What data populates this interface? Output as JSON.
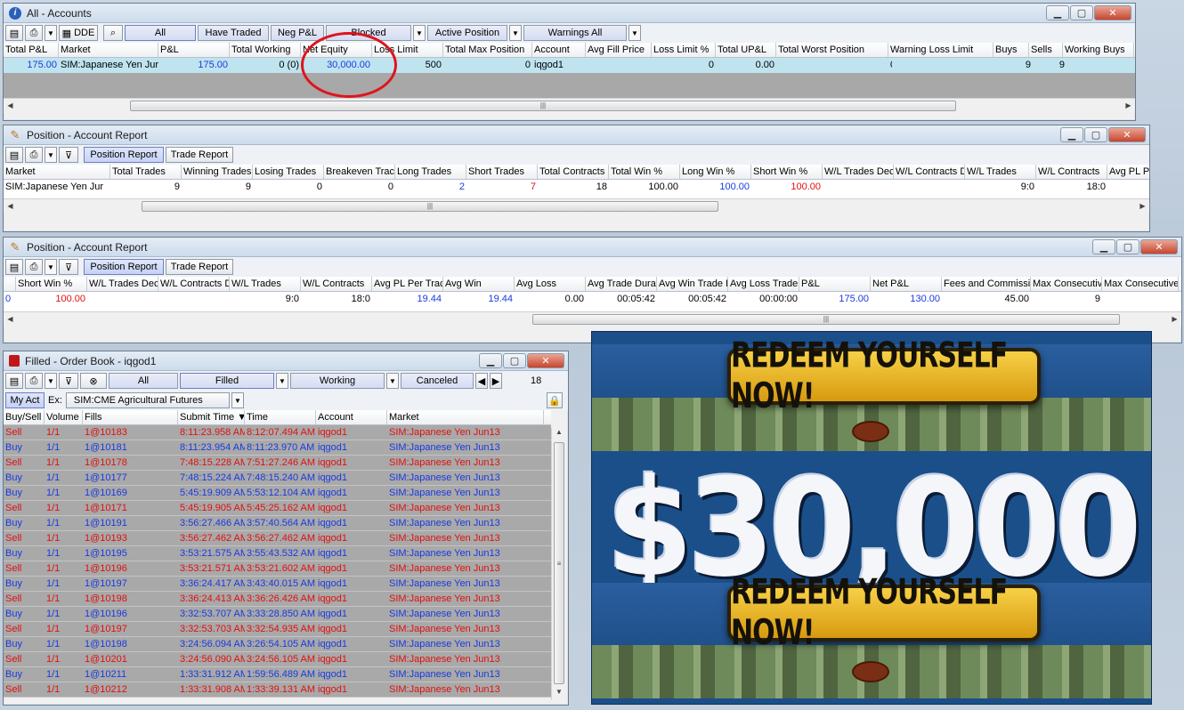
{
  "accounts_window": {
    "title": "All - Accounts",
    "toolbar": {
      "dde_label": "DDE",
      "filters": [
        "All",
        "Have Traded",
        "Neg P&L",
        "Blocked",
        "Active Position",
        "Warnings All"
      ]
    },
    "columns": [
      "Total P&L",
      "Market",
      "P&L",
      "Total Working",
      "Net Equity",
      "Loss Limit",
      "Total Max Position",
      "Account",
      "Avg Fill Price",
      "Loss Limit %",
      "Total UP&L",
      "Total Worst Position",
      "Warning Loss Limit",
      "Buys",
      "Sells",
      "Working Buys"
    ],
    "row": {
      "total_pl": "175.00",
      "market": "SIM:Japanese Yen Jur",
      "pl": "175.00",
      "total_working": "0 (0)",
      "net_equity": "30,000.00",
      "loss_limit": "500",
      "total_max_position": "0",
      "account": "iqgod1",
      "loss_limit_pct": "0",
      "total_upl": "0.00",
      "warning_loss_limit": "0",
      "buys": "9",
      "sells": "9"
    }
  },
  "position_report_1": {
    "title": "Position - Account Report",
    "tabs": [
      "Position Report",
      "Trade Report"
    ],
    "columns": [
      "Market",
      "Total Trades",
      "Winning Trades",
      "Losing Trades",
      "Breakeven Trac",
      "Long Trades",
      "Short Trades",
      "Total Contracts",
      "Total Win %",
      "Long Win %",
      "Short Win %",
      "W/L Trades Dec",
      "W/L Contracts D",
      "W/L Trades",
      "W/L Contracts",
      "Avg PL P"
    ],
    "row": {
      "market": "SIM:Japanese Yen Jur",
      "total_trades": "9",
      "winning_trades": "9",
      "losing_trades": "0",
      "breakeven": "0",
      "long_trades": "2",
      "short_trades": "7",
      "total_contracts": "18",
      "total_win": "100.00",
      "long_win": "100.00",
      "short_win": "100.00",
      "wl_trades": "9:0",
      "wl_contracts": "18:0"
    }
  },
  "position_report_2": {
    "title": "Position - Account Report",
    "tabs": [
      "Position Report",
      "Trade Report"
    ],
    "columns": [
      "Short Win %",
      "W/L Trades Dec",
      "W/L Contracts D",
      "W/L Trades",
      "W/L Contracts",
      "Avg PL Per Trac",
      "Avg Win",
      "Avg Loss",
      "Avg Trade Dura",
      "Avg Win Trade D",
      "Avg Loss Trade",
      "P&L",
      "Net P&L",
      "Fees and Commissi",
      "Max Consecutiv",
      "Max Consecutive"
    ],
    "row": {
      "lead": "0",
      "short_win": "100.00",
      "wl_trades": "9:0",
      "wl_contracts": "18:0",
      "avg_pl_per_trade": "19.44",
      "avg_win": "19.44",
      "avg_loss": "0.00",
      "avg_trade_duration": "00:05:42",
      "avg_win_trade_duration": "00:05:42",
      "avg_loss_trade_duration": "00:00:00",
      "pl": "175.00",
      "net_pl": "130.00",
      "fees": "45.00",
      "max_consecutive": "9"
    }
  },
  "order_book": {
    "title": "Filled - Order Book - iqgod1",
    "filters": [
      "All",
      "Filled",
      "Working",
      "Canceled"
    ],
    "count": "18",
    "my_act_label": "My Act",
    "ex_label": "Ex:",
    "exchange_value": "SIM:CME Agricultural Futures",
    "columns": [
      "Buy/Sell",
      "Volume",
      "Fills",
      "Submit Time",
      "Time",
      "Account",
      "Market"
    ],
    "rows": [
      {
        "side": "Sell",
        "volume": "1/1",
        "fills": "1@10183",
        "submit": "8:11:23.958 AM",
        "time": "8:12:07.494 AM",
        "account": "iqgod1",
        "market": "SIM:Japanese Yen Jun13"
      },
      {
        "side": "Buy",
        "volume": "1/1",
        "fills": "1@10181",
        "submit": "8:11:23.954 AM",
        "time": "8:11:23.970 AM",
        "account": "iqgod1",
        "market": "SIM:Japanese Yen Jun13"
      },
      {
        "side": "Sell",
        "volume": "1/1",
        "fills": "1@10178",
        "submit": "7:48:15.228 AM",
        "time": "7:51:27.246 AM",
        "account": "iqgod1",
        "market": "SIM:Japanese Yen Jun13"
      },
      {
        "side": "Buy",
        "volume": "1/1",
        "fills": "1@10177",
        "submit": "7:48:15.224 AM",
        "time": "7:48:15.240 AM",
        "account": "iqgod1",
        "market": "SIM:Japanese Yen Jun13"
      },
      {
        "side": "Buy",
        "volume": "1/1",
        "fills": "1@10169",
        "submit": "5:45:19.909 AM",
        "time": "5:53:12.104 AM",
        "account": "iqgod1",
        "market": "SIM:Japanese Yen Jun13"
      },
      {
        "side": "Sell",
        "volume": "1/1",
        "fills": "1@10171",
        "submit": "5:45:19.905 AM",
        "time": "5:45:25.162 AM",
        "account": "iqgod1",
        "market": "SIM:Japanese Yen Jun13"
      },
      {
        "side": "Buy",
        "volume": "1/1",
        "fills": "1@10191",
        "submit": "3:56:27.466 AM",
        "time": "3:57:40.564 AM",
        "account": "iqgod1",
        "market": "SIM:Japanese Yen Jun13"
      },
      {
        "side": "Sell",
        "volume": "1/1",
        "fills": "1@10193",
        "submit": "3:56:27.462 AM",
        "time": "3:56:27.462 AM",
        "account": "iqgod1",
        "market": "SIM:Japanese Yen Jun13"
      },
      {
        "side": "Buy",
        "volume": "1/1",
        "fills": "1@10195",
        "submit": "3:53:21.575 AM",
        "time": "3:55:43.532 AM",
        "account": "iqgod1",
        "market": "SIM:Japanese Yen Jun13"
      },
      {
        "side": "Sell",
        "volume": "1/1",
        "fills": "1@10196",
        "submit": "3:53:21.571 AM",
        "time": "3:53:21.602 AM",
        "account": "iqgod1",
        "market": "SIM:Japanese Yen Jun13"
      },
      {
        "side": "Buy",
        "volume": "1/1",
        "fills": "1@10197",
        "submit": "3:36:24.417 AM",
        "time": "3:43:40.015 AM",
        "account": "iqgod1",
        "market": "SIM:Japanese Yen Jun13"
      },
      {
        "side": "Sell",
        "volume": "1/1",
        "fills": "1@10198",
        "submit": "3:36:24.413 AM",
        "time": "3:36:26.426 AM",
        "account": "iqgod1",
        "market": "SIM:Japanese Yen Jun13"
      },
      {
        "side": "Buy",
        "volume": "1/1",
        "fills": "1@10196",
        "submit": "3:32:53.707 AM",
        "time": "3:33:28.850 AM",
        "account": "iqgod1",
        "market": "SIM:Japanese Yen Jun13"
      },
      {
        "side": "Sell",
        "volume": "1/1",
        "fills": "1@10197",
        "submit": "3:32:53.703 AM",
        "time": "3:32:54.935 AM",
        "account": "iqgod1",
        "market": "SIM:Japanese Yen Jun13"
      },
      {
        "side": "Buy",
        "volume": "1/1",
        "fills": "1@10198",
        "submit": "3:24:56.094 AM",
        "time": "3:26:54.105 AM",
        "account": "iqgod1",
        "market": "SIM:Japanese Yen Jun13"
      },
      {
        "side": "Sell",
        "volume": "1/1",
        "fills": "1@10201",
        "submit": "3:24:56.090 AM",
        "time": "3:24:56.105 AM",
        "account": "iqgod1",
        "market": "SIM:Japanese Yen Jun13"
      },
      {
        "side": "Buy",
        "volume": "1/1",
        "fills": "1@10211",
        "submit": "1:33:31.912 AM",
        "time": "1:59:56.489 AM",
        "account": "iqgod1",
        "market": "SIM:Japanese Yen Jun13"
      },
      {
        "side": "Sell",
        "volume": "1/1",
        "fills": "1@10212",
        "submit": "1:33:31.908 AM",
        "time": "1:33:39.131 AM",
        "account": "iqgod1",
        "market": "SIM:Japanese Yen Jun13"
      }
    ]
  },
  "advert": {
    "banner_top": "REDEEM YOURSELF NOW!",
    "amount": "$30,000",
    "banner_bottom": "REDEEM YOURSELF NOW!"
  },
  "colors": {
    "buy": "#1a3adf",
    "sell": "#e11010",
    "highlight": "#e0141c"
  }
}
